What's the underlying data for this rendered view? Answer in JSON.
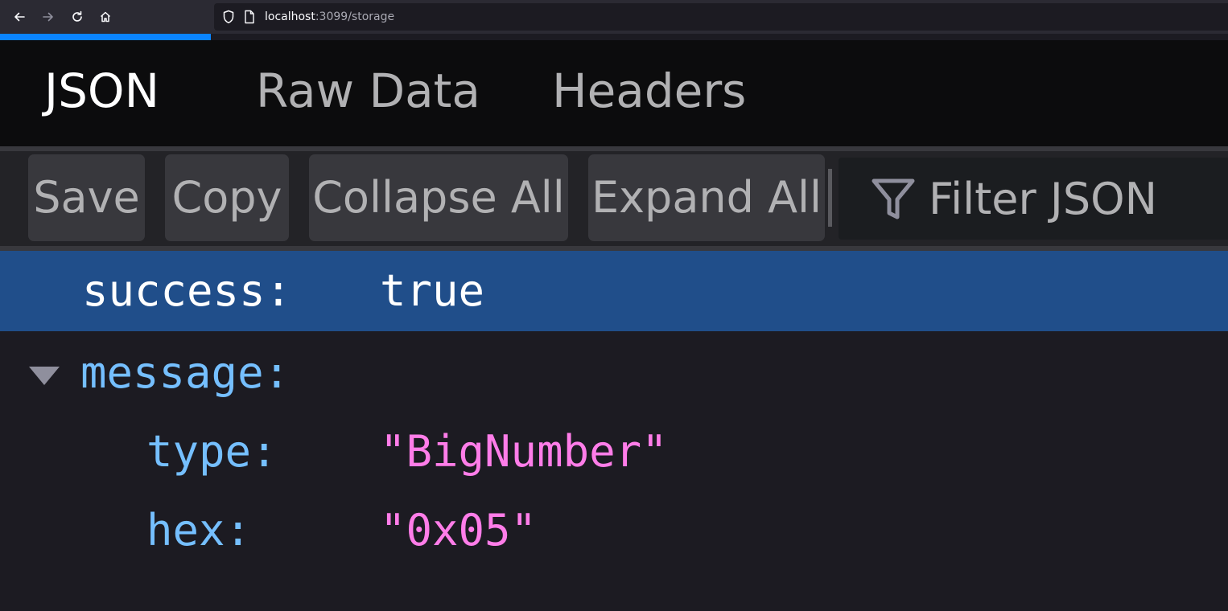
{
  "browser": {
    "url_host": "localhost",
    "url_rest": ":3099/storage",
    "icons": [
      "back-icon",
      "forward-icon",
      "reload-icon",
      "home-icon",
      "shield-icon",
      "page-icon"
    ]
  },
  "tabs": [
    {
      "label": "JSON",
      "selected": true
    },
    {
      "label": "Raw Data",
      "selected": false
    },
    {
      "label": "Headers",
      "selected": false
    }
  ],
  "toolbar": {
    "save_label": "Save",
    "copy_label": "Copy",
    "collapse_label": "Collapse All",
    "expand_label": "Expand All",
    "filter_placeholder": "Filter JSON",
    "filter_icon": "filter-icon"
  },
  "json_tree": {
    "rows": [
      {
        "key": "success:",
        "value": "true",
        "selected": true
      },
      {
        "key": "message:",
        "expanded": true
      },
      {
        "key": "type:",
        "value": "\"BigNumber\""
      },
      {
        "key": "hex:",
        "value": "\"0x05\""
      }
    ]
  },
  "colors": {
    "accent": "#0a84ff",
    "selection": "#204e8a",
    "key": "#75bfff",
    "string": "#ff7de9"
  }
}
